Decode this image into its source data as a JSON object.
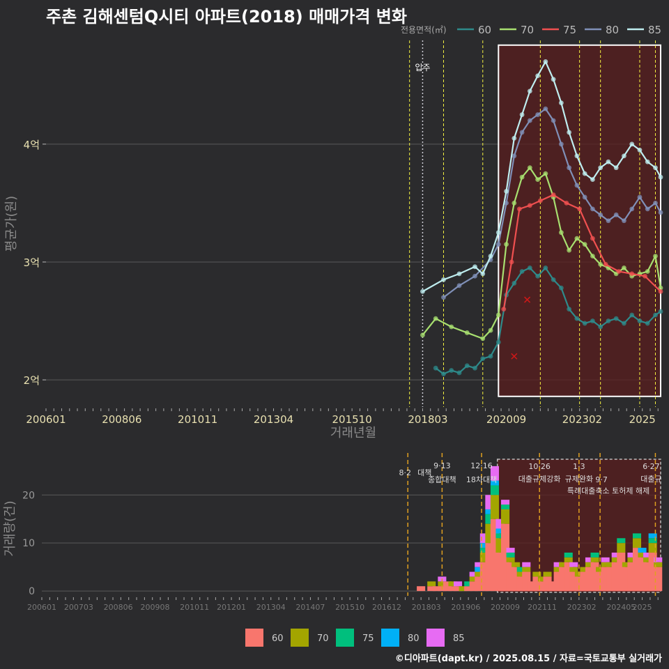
{
  "title": "주촌 김해센텀Q시티 아파트(2018) 매매가격 변화",
  "credit": "©디아파트(dapt.kr) / 2025.08.15 / 자료=국토교통부 실거래가",
  "colors": {
    "bg": "#2b2b2d",
    "grid": "#5a5a5a",
    "axis_text": "#e8e0b0",
    "axis_title": "#8a8a8a",
    "vline": "#f5f240",
    "vline_bar": "#e0a020",
    "region_fill": "#5a1e1e",
    "region_border": "#ffffff",
    "price_series": {
      "60": "#2e8b8b",
      "70": "#a8e070",
      "75": "#f05050",
      "80": "#8090b8",
      "85": "#bfeef0"
    },
    "volume_series": {
      "60": "#f8766d",
      "70": "#a3a500",
      "75": "#00bf7d",
      "80": "#00b0f6",
      "85": "#e76bf3"
    }
  },
  "chart_data": [
    {
      "type": "line",
      "title": "주촌 김해센텀Q시티 아파트(2018) 매매가격 변화",
      "xlabel": "거래년월",
      "ylabel": "평균가(원)",
      "legend_title": "전용면적(㎡)",
      "legend_position": "top-right",
      "x_ticks": [
        "200601",
        "200806",
        "201011",
        "201304",
        "201510",
        "201803",
        "202009",
        "202302",
        "2025"
      ],
      "y_ticks": [
        {
          "value": 2.0,
          "label": "2억"
        },
        {
          "value": 3.0,
          "label": "3억"
        },
        {
          "value": 4.0,
          "label": "4억"
        }
      ],
      "y_unit": "억",
      "ylim": [
        1.77,
        4.88
      ],
      "xlim": [
        "2006-01",
        "2025-08"
      ],
      "grid": true,
      "annotation": {
        "label": "입주",
        "x": "2018-01"
      },
      "vlines": [
        "2017-08",
        "2018-09",
        "2019-12",
        "2021-10",
        "2023-01",
        "2023-09",
        "2024-12",
        "2025-06"
      ],
      "highlight_region": {
        "x": [
          "2020-06",
          "2025-08"
        ],
        "y": [
          1.86,
          4.84
        ]
      },
      "markers_x": [
        {
          "x": "2020-12",
          "y": 2.2
        },
        {
          "x": "2021-05",
          "y": 2.68
        }
      ],
      "series": [
        {
          "name": "60",
          "points": [
            [
              "2018-06",
              2.1
            ],
            [
              "2018-09",
              2.05
            ],
            [
              "2018-12",
              2.08
            ],
            [
              "2019-03",
              2.06
            ],
            [
              "2019-06",
              2.12
            ],
            [
              "2019-09",
              2.1
            ],
            [
              "2019-12",
              2.18
            ],
            [
              "2020-03",
              2.2
            ],
            [
              "2020-06",
              2.32
            ],
            [
              "2020-09",
              2.72
            ],
            [
              "2020-12",
              2.82
            ],
            [
              "2021-03",
              2.92
            ],
            [
              "2021-06",
              2.95
            ],
            [
              "2021-09",
              2.88
            ],
            [
              "2021-12",
              2.95
            ],
            [
              "2022-03",
              2.85
            ],
            [
              "2022-06",
              2.78
            ],
            [
              "2022-09",
              2.6
            ],
            [
              "2022-12",
              2.52
            ],
            [
              "2023-03",
              2.48
            ],
            [
              "2023-06",
              2.5
            ],
            [
              "2023-09",
              2.45
            ],
            [
              "2023-12",
              2.5
            ],
            [
              "2024-03",
              2.52
            ],
            [
              "2024-06",
              2.48
            ],
            [
              "2024-09",
              2.55
            ],
            [
              "2024-12",
              2.5
            ],
            [
              "2025-03",
              2.48
            ],
            [
              "2025-06",
              2.55
            ],
            [
              "2025-08",
              2.58
            ]
          ]
        },
        {
          "name": "70",
          "points": [
            [
              "2018-01",
              2.38
            ],
            [
              "2018-06",
              2.52
            ],
            [
              "2018-12",
              2.45
            ],
            [
              "2019-06",
              2.4
            ],
            [
              "2019-12",
              2.35
            ],
            [
              "2020-03",
              2.42
            ],
            [
              "2020-06",
              2.55
            ],
            [
              "2020-09",
              3.15
            ],
            [
              "2020-12",
              3.5
            ],
            [
              "2021-03",
              3.72
            ],
            [
              "2021-06",
              3.8
            ],
            [
              "2021-09",
              3.7
            ],
            [
              "2021-12",
              3.75
            ],
            [
              "2022-03",
              3.55
            ],
            [
              "2022-06",
              3.25
            ],
            [
              "2022-09",
              3.1
            ],
            [
              "2022-12",
              3.2
            ],
            [
              "2023-03",
              3.15
            ],
            [
              "2023-06",
              3.05
            ],
            [
              "2023-09",
              2.98
            ],
            [
              "2023-12",
              2.95
            ],
            [
              "2024-03",
              2.9
            ],
            [
              "2024-06",
              2.95
            ],
            [
              "2024-09",
              2.88
            ],
            [
              "2024-12",
              2.9
            ],
            [
              "2025-03",
              2.92
            ],
            [
              "2025-06",
              3.05
            ],
            [
              "2025-08",
              2.78
            ]
          ]
        },
        {
          "name": "75",
          "points": [
            [
              "2020-08",
              2.6
            ],
            [
              "2020-11",
              3.0
            ],
            [
              "2021-02",
              3.45
            ],
            [
              "2021-06",
              3.48
            ],
            [
              "2021-10",
              3.52
            ],
            [
              "2022-03",
              3.57
            ],
            [
              "2022-08",
              3.5
            ],
            [
              "2023-01",
              3.45
            ],
            [
              "2023-06",
              3.2
            ],
            [
              "2023-11",
              2.98
            ],
            [
              "2024-04",
              2.92
            ],
            [
              "2024-09",
              2.9
            ],
            [
              "2025-02",
              2.88
            ],
            [
              "2025-08",
              2.75
            ]
          ]
        },
        {
          "name": "80",
          "points": [
            [
              "2018-09",
              2.7
            ],
            [
              "2019-03",
              2.8
            ],
            [
              "2019-09",
              2.88
            ],
            [
              "2020-03",
              3.02
            ],
            [
              "2020-06",
              3.15
            ],
            [
              "2020-09",
              3.5
            ],
            [
              "2020-12",
              3.9
            ],
            [
              "2021-03",
              4.1
            ],
            [
              "2021-06",
              4.2
            ],
            [
              "2021-09",
              4.25
            ],
            [
              "2021-12",
              4.3
            ],
            [
              "2022-03",
              4.2
            ],
            [
              "2022-06",
              4.0
            ],
            [
              "2022-09",
              3.8
            ],
            [
              "2022-12",
              3.65
            ],
            [
              "2023-03",
              3.55
            ],
            [
              "2023-06",
              3.45
            ],
            [
              "2023-09",
              3.4
            ],
            [
              "2023-12",
              3.35
            ],
            [
              "2024-03",
              3.4
            ],
            [
              "2024-06",
              3.35
            ],
            [
              "2024-09",
              3.45
            ],
            [
              "2024-12",
              3.55
            ],
            [
              "2025-03",
              3.45
            ],
            [
              "2025-06",
              3.5
            ],
            [
              "2025-08",
              3.42
            ]
          ]
        },
        {
          "name": "85",
          "points": [
            [
              "2018-01",
              2.75
            ],
            [
              "2018-09",
              2.85
            ],
            [
              "2019-03",
              2.9
            ],
            [
              "2019-09",
              2.96
            ],
            [
              "2019-12",
              2.9
            ],
            [
              "2020-03",
              3.05
            ],
            [
              "2020-06",
              3.25
            ],
            [
              "2020-09",
              3.6
            ],
            [
              "2020-12",
              4.05
            ],
            [
              "2021-03",
              4.25
            ],
            [
              "2021-06",
              4.45
            ],
            [
              "2021-09",
              4.58
            ],
            [
              "2021-12",
              4.7
            ],
            [
              "2022-03",
              4.55
            ],
            [
              "2022-06",
              4.35
            ],
            [
              "2022-09",
              4.1
            ],
            [
              "2022-12",
              3.9
            ],
            [
              "2023-03",
              3.75
            ],
            [
              "2023-06",
              3.7
            ],
            [
              "2023-09",
              3.8
            ],
            [
              "2023-12",
              3.85
            ],
            [
              "2024-03",
              3.8
            ],
            [
              "2024-06",
              3.9
            ],
            [
              "2024-09",
              4.0
            ],
            [
              "2024-12",
              3.95
            ],
            [
              "2025-03",
              3.85
            ],
            [
              "2025-06",
              3.8
            ],
            [
              "2025-08",
              3.72
            ]
          ]
        }
      ]
    },
    {
      "type": "bar",
      "stacked": true,
      "ylabel": "거래량(건)",
      "legend_position": "bottom",
      "x_ticks": [
        "200601",
        "200703",
        "200806",
        "200908",
        "201011",
        "201201",
        "201304",
        "201407",
        "201510",
        "201612",
        "201803",
        "201906",
        "202009",
        "202111",
        "202302",
        "202405",
        "2025"
      ],
      "y_ticks": [
        0,
        10,
        20
      ],
      "ylim": [
        -1,
        27
      ],
      "xlim": [
        "2006-01",
        "2025-08"
      ],
      "grid": true,
      "highlight_region": {
        "x": [
          "2020-06",
          "2025-08"
        ]
      },
      "policy_events": [
        {
          "x": "2017-08",
          "date": "8·2",
          "text": "대책"
        },
        {
          "x": "2018-09",
          "date": "9·13",
          "text": "종합대책"
        },
        {
          "x": "2019-12",
          "date": "12·16",
          "text": "18차대책"
        },
        {
          "x": "2021-10",
          "date": "10·26",
          "text": "대출규제강화"
        },
        {
          "x": "2023-01",
          "date": "1·3",
          "text": "규제완화"
        },
        {
          "x": "2023-09",
          "date": "9·7",
          "text": "특례대출축소 토허제 해제"
        },
        {
          "x": "2025-06",
          "date": "6·27",
          "text": "대출규"
        }
      ],
      "series_names": [
        "60",
        "70",
        "75",
        "80",
        "85"
      ],
      "months": [
        "2018-01",
        "2018-03",
        "2018-05",
        "2018-07",
        "2018-09",
        "2018-11",
        "2019-01",
        "2019-03",
        "2019-05",
        "2019-07",
        "2019-09",
        "2019-11",
        "2020-01",
        "2020-03",
        "2020-05",
        "2020-07",
        "2020-09",
        "2020-11",
        "2021-01",
        "2021-03",
        "2021-05",
        "2021-07",
        "2021-09",
        "2021-11",
        "2022-01",
        "2022-03",
        "2022-05",
        "2022-07",
        "2022-09",
        "2022-11",
        "2023-01",
        "2023-03",
        "2023-05",
        "2023-07",
        "2023-09",
        "2023-11",
        "2024-01",
        "2024-03",
        "2024-05",
        "2024-07",
        "2024-09",
        "2024-11",
        "2025-01",
        "2025-03",
        "2025-05",
        "2025-07"
      ],
      "values": {
        "60": [
          1,
          0,
          1,
          1,
          1,
          2,
          1,
          1,
          0,
          1,
          2,
          3,
          6,
          10,
          15,
          8,
          14,
          6,
          5,
          3,
          4,
          2,
          3,
          2,
          3,
          2,
          4,
          5,
          6,
          4,
          3,
          4,
          5,
          6,
          4,
          5,
          5,
          6,
          8,
          5,
          6,
          9,
          7,
          6,
          8,
          5
        ],
        "70": [
          0,
          0,
          1,
          0,
          1,
          0,
          1,
          0,
          1,
          0,
          1,
          1,
          2,
          4,
          5,
          3,
          3,
          1,
          1,
          1,
          1,
          0,
          1,
          1,
          1,
          0,
          1,
          1,
          1,
          1,
          1,
          1,
          1,
          1,
          1,
          1,
          1,
          1,
          2,
          1,
          1,
          2,
          1,
          1,
          2,
          1
        ],
        "75": [
          0,
          0,
          0,
          0,
          0,
          0,
          0,
          0,
          0,
          1,
          0,
          0,
          1,
          2,
          2,
          1,
          1,
          1,
          0,
          1,
          0,
          0,
          0,
          0,
          0,
          0,
          0,
          0,
          1,
          0,
          0,
          0,
          0,
          1,
          0,
          0,
          0,
          0,
          1,
          0,
          0,
          1,
          0,
          0,
          1,
          0
        ],
        "80": [
          0,
          0,
          0,
          0,
          0,
          0,
          0,
          0,
          0,
          0,
          0,
          1,
          1,
          1,
          1,
          1,
          0,
          0,
          0,
          0,
          0,
          0,
          0,
          0,
          0,
          0,
          0,
          0,
          0,
          0,
          0,
          0,
          0,
          0,
          0,
          0,
          0,
          0,
          0,
          0,
          0,
          0,
          1,
          0,
          1,
          0
        ],
        "85": [
          0,
          0,
          0,
          0,
          1,
          0,
          0,
          1,
          0,
          0,
          1,
          1,
          2,
          3,
          3,
          2,
          1,
          1,
          0,
          0,
          1,
          0,
          0,
          0,
          0,
          0,
          1,
          0,
          0,
          1,
          0,
          0,
          1,
          0,
          0,
          1,
          0,
          1,
          0,
          0,
          1,
          0,
          0,
          1,
          0,
          1
        ]
      }
    }
  ]
}
